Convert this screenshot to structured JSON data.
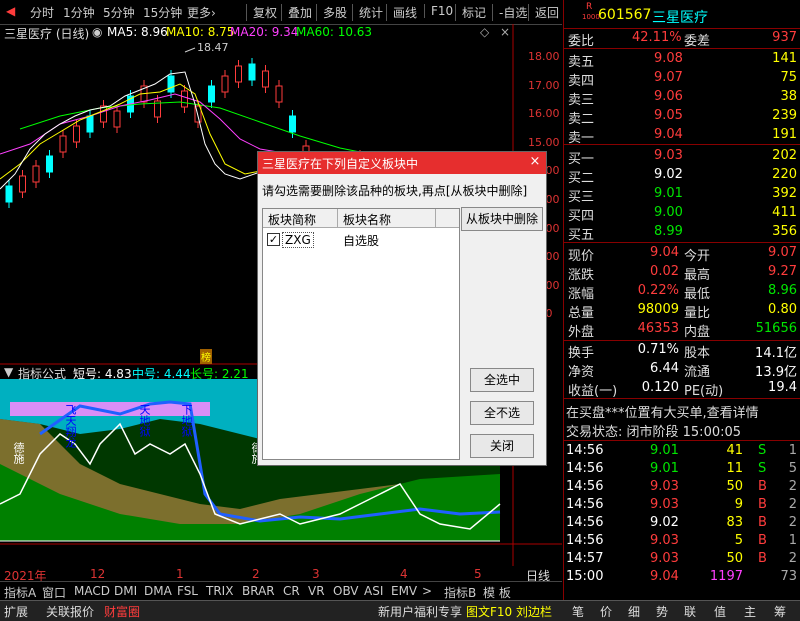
{
  "toolbar": {
    "items": [
      "分时",
      "1分钟",
      "5分钟",
      "15分钟",
      "更多",
      "复权",
      "叠加",
      "多股",
      "统计",
      "画线",
      "F10",
      "标记",
      "-自选",
      "返回"
    ],
    "more_arrow": "›"
  },
  "main_chart": {
    "title": "三星医疗 (日线)",
    "ma5": "MA5: 8.96",
    "ma10": "MA10: 8.75",
    "ma20": "MA20: 9.34",
    "ma60": "MA60: 10.63",
    "high_marker": "18.47",
    "price_labels": [
      "18.00",
      "17.00",
      "16.00",
      "15.00",
      "14.00",
      "13.00",
      "12.00",
      "11.00",
      "10.00",
      "9.00"
    ],
    "badge": "榜",
    "colors": {
      "ma5": "#ffffff",
      "ma10": "#ffff00",
      "ma20": "#ff40ff",
      "ma60": "#00ff00"
    }
  },
  "indicator": {
    "title": "指标公式",
    "short": "短号: 4.83",
    "mid": "中号: 4.44",
    "long": "长号: 2.21",
    "annotations": [
      "德施",
      "飞天翔龙",
      "天地狱",
      "下地狱",
      "下地狱",
      "德施"
    ]
  },
  "xaxis": {
    "labels": [
      "2021年",
      "12",
      "1",
      "2",
      "3",
      "4",
      "5"
    ],
    "right": "日线"
  },
  "bottom_tabs": [
    "指标A",
    "窗口",
    "MACD",
    "DMI",
    "DMA",
    "FSL",
    "TRIX",
    "BRAR",
    "CR",
    "VR",
    "OBV",
    "ASI",
    "EMV"
  ],
  "bottom_tabs_right": {
    "arrow": ">",
    "indB": "指标B",
    "template": "模 板"
  },
  "status": {
    "left": [
      "扩展",
      "关联报价",
      "财富圈"
    ],
    "mid": [
      "新用户福利专享",
      "图文F10",
      "刘边栏"
    ],
    "right": [
      "笔",
      "价",
      "细",
      "势",
      "联",
      "值",
      "主",
      "筹"
    ]
  },
  "quote": {
    "code": "601567",
    "name": "三星医疗",
    "r_badge": "R",
    "r_sub": "1000",
    "weibi_label": "委比",
    "weibi": "42.11%",
    "weicha_label": "委差",
    "weicha": "937",
    "sells": [
      [
        "卖五",
        "9.08",
        "141"
      ],
      [
        "卖四",
        "9.07",
        "75"
      ],
      [
        "卖三",
        "9.06",
        "38"
      ],
      [
        "卖二",
        "9.05",
        "239"
      ],
      [
        "卖一",
        "9.04",
        "191"
      ]
    ],
    "buys": [
      [
        "买一",
        "9.03",
        "202"
      ],
      [
        "买二",
        "9.02",
        "220"
      ],
      [
        "买三",
        "9.01",
        "392"
      ],
      [
        "买四",
        "9.00",
        "411"
      ],
      [
        "买五",
        "8.99",
        "356"
      ]
    ],
    "stats": [
      [
        "现价",
        "9.04",
        "今开",
        "9.07"
      ],
      [
        "涨跌",
        "0.02",
        "最高",
        "9.27"
      ],
      [
        "涨幅",
        "0.22%",
        "最低",
        "8.96"
      ],
      [
        "总量",
        "98009",
        "量比",
        "0.80"
      ],
      [
        "外盘",
        "46353",
        "内盘",
        "51656"
      ]
    ],
    "stats2": [
      [
        "换手",
        "0.71%",
        "股本",
        "14.1亿"
      ],
      [
        "净资",
        "6.44",
        "流通",
        "13.9亿"
      ],
      [
        "收益(一)",
        "0.120",
        "PE(动)",
        "19.4"
      ]
    ],
    "notice": "在买盘***位置有大买单,查看详情",
    "trade_status": "交易状态: 闭市阶段  15:00:05",
    "ticks": [
      [
        "14:56",
        "9.01",
        "41",
        "S",
        "1"
      ],
      [
        "14:56",
        "9.01",
        "11",
        "S",
        "5"
      ],
      [
        "14:56",
        "9.03",
        "50",
        "B",
        "2"
      ],
      [
        "14:56",
        "9.03",
        "9",
        "B",
        "2"
      ],
      [
        "14:56",
        "9.02",
        "83",
        "B",
        "2"
      ],
      [
        "14:56",
        "9.03",
        "5",
        "B",
        "1"
      ],
      [
        "14:57",
        "9.03",
        "50",
        "B",
        "2"
      ],
      [
        "15:00",
        "9.04",
        "1197",
        "",
        "73"
      ]
    ]
  },
  "dialog": {
    "title": "三星医疗在下列自定义板块中",
    "close": "×",
    "instruction": "请勾选需要删除该品种的板块,再点[从板块中删除]",
    "col1": "板块简称",
    "col2": "板块名称",
    "rows": [
      {
        "short": "ZXG",
        "name": "自选股",
        "checked": true
      }
    ],
    "remove_button": "从板块中删除",
    "select_all": "全选中",
    "select_none": "全不选",
    "close_button": "关闭"
  }
}
